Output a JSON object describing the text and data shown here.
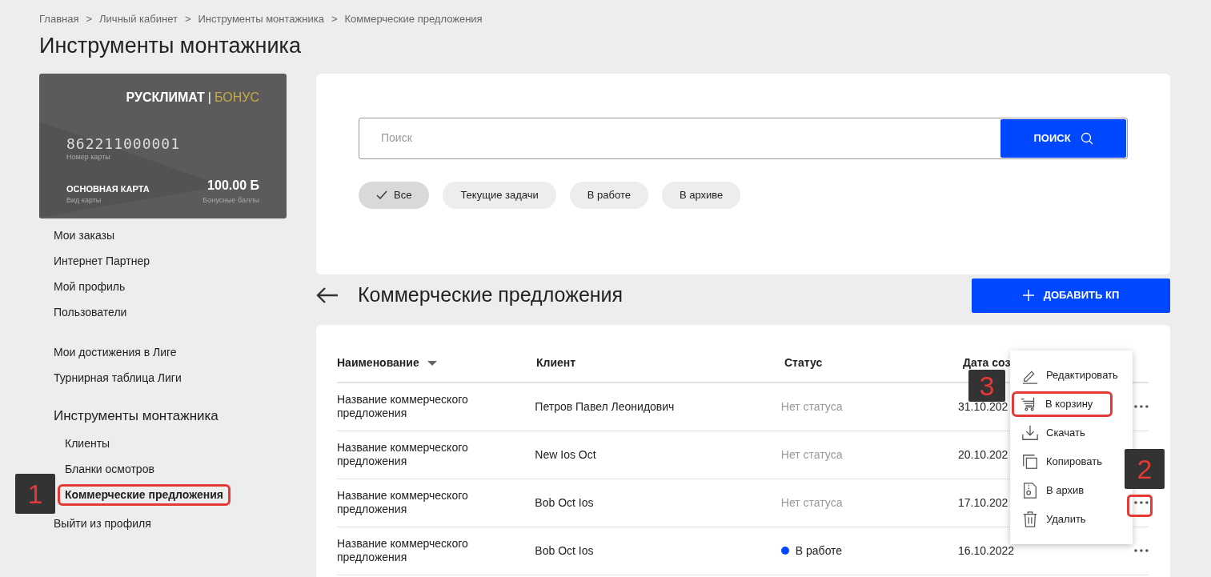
{
  "breadcrumbs": [
    "Главная",
    "Личный кабинет",
    "Инструменты монтажника",
    "Коммерческие предложения"
  ],
  "breadcrumb_separator": ">",
  "page_title": "Инструменты монтажника",
  "bonus_card": {
    "brand": "РУСКЛИМАТ",
    "brand_separator": "|",
    "brand_suffix": "БОНУС",
    "number": "862211000001",
    "number_label": "Номер карты",
    "type": "ОСНОВНАЯ КАРТА",
    "type_label": "Вид карты",
    "points": "100.00 Б",
    "points_label": "Бонусные баллы"
  },
  "sidebar": {
    "groups": [
      {
        "items": [
          {
            "label": "Мои заказы"
          },
          {
            "label": "Интернет Партнер"
          },
          {
            "label": "Мой профиль"
          },
          {
            "label": "Пользователи"
          }
        ]
      },
      {
        "items": [
          {
            "label": "Мои достижения в Лиге"
          },
          {
            "label": "Турнирная таблица Лиги"
          }
        ]
      }
    ],
    "section": {
      "title": "Инструменты монтажника",
      "items": [
        {
          "label": "Клиенты",
          "selected": false
        },
        {
          "label": "Бланки осмотров",
          "selected": false
        },
        {
          "label": "Коммерческие предложения",
          "selected": true
        }
      ]
    },
    "logout": "Выйти из профиля"
  },
  "search": {
    "placeholder": "Поиск",
    "button": "ПОИСК"
  },
  "filters": [
    {
      "label": "Все",
      "selected": true
    },
    {
      "label": "Текущие задачи",
      "selected": false
    },
    {
      "label": "В работе",
      "selected": false
    },
    {
      "label": "В архиве",
      "selected": false
    }
  ],
  "section_title": "Коммерческие предложения",
  "add_button": "ДОБАВИТЬ КП",
  "table": {
    "columns": [
      "Наименование",
      "Клиент",
      "Статус",
      "Дата соз"
    ],
    "rows": [
      {
        "name": "Название коммерческого предложения",
        "client": "Петров Павел Леонидович",
        "status": "Нет статуса",
        "date": "31.10.202"
      },
      {
        "name": "Название коммерческого предложения",
        "client": "New Ios Oct",
        "status": "Нет статуса",
        "date": "20.10.202"
      },
      {
        "name": "Название коммерческого предложения",
        "client": "Bob Oct Ios",
        "status": "Нет статуса",
        "date": "17.10.202"
      },
      {
        "name": "Название коммерческого предложения",
        "client": "Bob Oct Ios",
        "status": "В работе",
        "color": "#0047ff",
        "date": "16.10.2022"
      }
    ]
  },
  "context_menu": [
    {
      "kind": "edit",
      "label": "Редактировать",
      "highlighted": false
    },
    {
      "kind": "cart",
      "label": "В корзину",
      "highlighted": true
    },
    {
      "kind": "download",
      "label": "Скачать",
      "highlighted": false
    },
    {
      "kind": "copy",
      "label": "Копировать",
      "highlighted": false
    },
    {
      "kind": "archive",
      "label": "В архив",
      "highlighted": false
    },
    {
      "kind": "delete",
      "label": "Удалить",
      "highlighted": false
    }
  ],
  "annotations": [
    "1",
    "2",
    "3"
  ]
}
